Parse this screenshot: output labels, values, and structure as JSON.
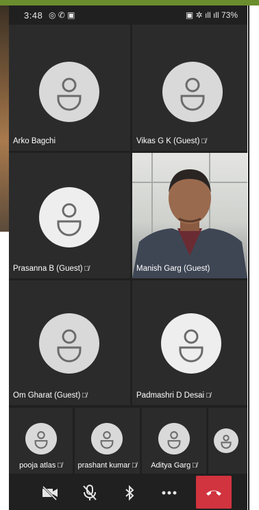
{
  "status": {
    "time": "3:48",
    "left_icons": "◎ ✆ ▣",
    "right_icons": "▣ ✲ ıll ıll",
    "battery": "73%"
  },
  "participants": [
    {
      "name": "Arko  Bagchi",
      "muted": false
    },
    {
      "name": "Vikas G K (Guest)",
      "muted": true
    },
    {
      "name": "Prasanna B (Guest)",
      "muted": true
    },
    {
      "name": "Manish Garg (Guest)",
      "muted": false,
      "video": true
    },
    {
      "name": "Om Gharat (Guest)",
      "muted": true
    },
    {
      "name": "Padmashri D Desai",
      "muted": true
    }
  ],
  "small_participants": [
    {
      "name": "pooja atlas",
      "muted": true
    },
    {
      "name": "prashant kumar",
      "muted": true
    },
    {
      "name": "Aditya Garg",
      "muted": true
    },
    {
      "name": "",
      "muted": false
    }
  ],
  "icons": {
    "mute": "mic-off-icon",
    "camera": "camera-off-icon",
    "bluetooth": "bluetooth-icon",
    "more": "more-icon",
    "hangup": "hangup-icon"
  },
  "colors": {
    "tile_bg": "#2b2b2b",
    "avatar_bg": "#d9d9d9",
    "hangup": "#d1333f"
  }
}
